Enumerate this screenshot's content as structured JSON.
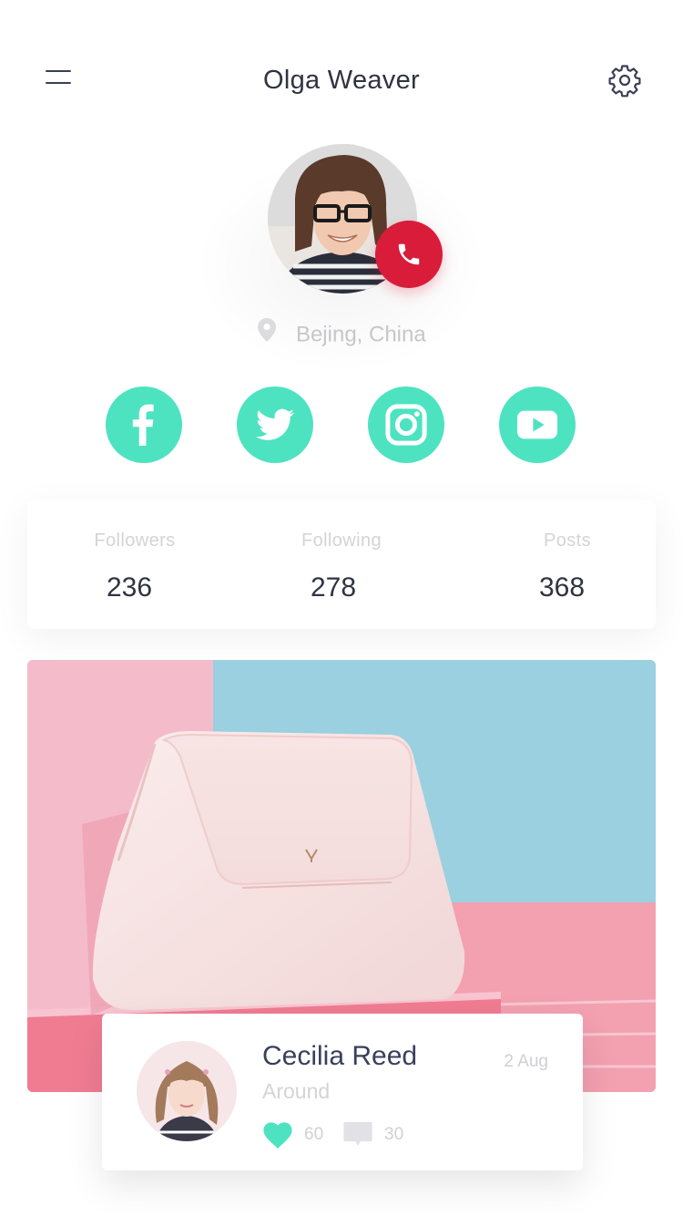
{
  "header": {
    "title": "Olga Weaver",
    "menu_icon": "hamburger-menu-icon",
    "settings_icon": "gear-icon"
  },
  "profile": {
    "location": "Bejing, China",
    "call_icon": "phone-icon",
    "call_color": "#d81c3a"
  },
  "social": {
    "accent_color": "#4de3c0",
    "items": [
      {
        "name": "facebook",
        "icon": "facebook-icon"
      },
      {
        "name": "twitter",
        "icon": "twitter-icon"
      },
      {
        "name": "instagram",
        "icon": "instagram-icon"
      },
      {
        "name": "youtube",
        "icon": "youtube-icon"
      }
    ]
  },
  "stats": {
    "followers_label": "Followers",
    "followers_value": "236",
    "following_label": "Following",
    "following_value": "278",
    "posts_label": "Posts",
    "posts_value": "368"
  },
  "post": {
    "author": "Cecilia Reed",
    "subtitle": "Around",
    "date": "2 Aug",
    "likes": "60",
    "comments": "30",
    "like_icon": "heart-icon",
    "comment_icon": "comment-icon"
  }
}
